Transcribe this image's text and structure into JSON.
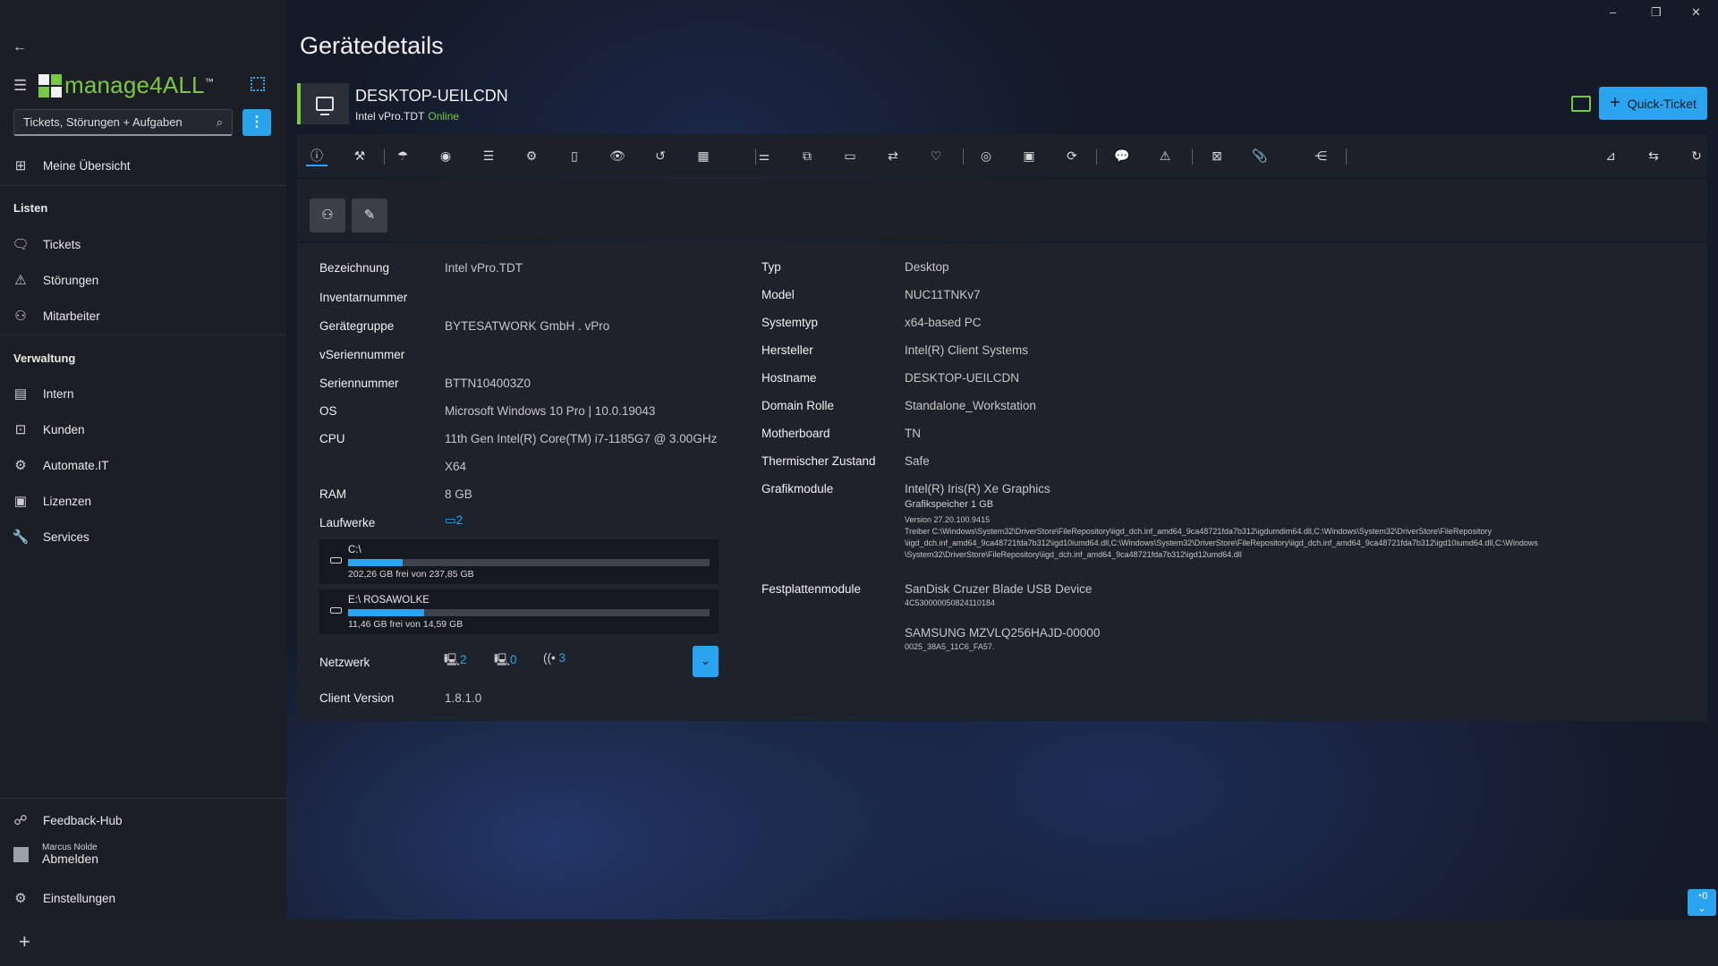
{
  "app": {
    "logo_text": "manage4ALL",
    "logo_tm": "™",
    "window_controls": [
      "–",
      "❐",
      "✕"
    ]
  },
  "search": {
    "placeholder": "Tickets, Störungen + Aufgaben"
  },
  "nav": {
    "overview": "Meine Übersicht",
    "lists_heading": "Listen",
    "tickets": "Tickets",
    "stoerungen": "Störungen",
    "mitarbeiter": "Mitarbeiter",
    "admin_heading": "Verwaltung",
    "intern": "Intern",
    "kunden": "Kunden",
    "automate": "Automate.IT",
    "lizenzen": "Lizenzen",
    "services": "Services",
    "feedback": "Feedback-Hub",
    "user_name": "Marcus Nolde",
    "logout": "Abmelden",
    "settings": "Einstellungen"
  },
  "page": {
    "title": "Gerätedetails"
  },
  "device": {
    "name": "DESKTOP-UEILCDN",
    "sub": "Intel vPro.TDT",
    "status": "Online",
    "status_color": "#7ac943"
  },
  "header": {
    "quick_ticket": "Quick-Ticket",
    "accent": "#2aa4ee"
  },
  "toolbar": {
    "icons": [
      "info-icon",
      "wrench-icon",
      "umbrella-icon",
      "target-icon",
      "list-icon",
      "cogs-icon",
      "battery-icon",
      "eye-icon",
      "history-icon",
      "calendar-icon",
      "sliders-icon",
      "package-icon",
      "monitor-icon",
      "transfer-icon",
      "heartbeat-icon",
      "camera-icon",
      "storage-icon",
      "refresh-icon",
      "chat-icon",
      "warning-icon",
      "badge-icon",
      "paperclip-icon",
      "share-icon",
      "chart-icon",
      "sync-icon",
      "reload-icon"
    ]
  },
  "left": {
    "bezeichnung_l": "Bezeichnung",
    "bezeichnung_v": "Intel vPro.TDT",
    "inventar_l": "Inventarnummer",
    "gruppe_l": "Gerätegruppe",
    "gruppe_v": "BYTESATWORK GmbH . vPro",
    "vserien_l": "vSeriennummer",
    "serien_l": "Seriennummer",
    "serien_v": "BTTN104003Z0",
    "os_l": "OS",
    "os_v": "Microsoft Windows 10 Pro | 10.0.19043",
    "cpu_l": "CPU",
    "cpu_v": "11th Gen Intel(R) Core(TM) i7-1185G7 @ 3.00GHz",
    "cpu_arch": "X64",
    "ram_l": "RAM",
    "ram_v": "8 GB",
    "laufwerke_l": "Laufwerke",
    "laufwerke_count": "2",
    "drives": [
      {
        "name": "C:\\",
        "free": "202,26 GB frei von 237,85 GB",
        "used_fraction": 0.15
      },
      {
        "name": "E:\\ ROSAWOLKE",
        "free": "11,46 GB frei von 14,59 GB",
        "used_fraction": 0.21
      }
    ],
    "netzwerk_l": "Netzwerk",
    "net_lan": "2",
    "net_other": "0",
    "net_wifi": "3",
    "client_l": "Client Version",
    "client_v": "1.8.1.0"
  },
  "right": {
    "typ_l": "Typ",
    "typ_v": "Desktop",
    "model_l": "Model",
    "model_v": "NUC11TNKv7",
    "systemtyp_l": "Systemtyp",
    "systemtyp_v": "x64-based PC",
    "hersteller_l": "Hersteller",
    "hersteller_v": "Intel(R) Client Systems",
    "hostname_l": "Hostname",
    "hostname_v": "DESKTOP-UEILCDN",
    "domain_l": "Domain Rolle",
    "domain_v": "Standalone_Workstation",
    "mb_l": "Motherboard",
    "mb_v": "TN",
    "thermal_l": "Thermischer Zustand",
    "thermal_v": "Safe",
    "grafik_l": "Grafikmodule",
    "grafik_v": "Intel(R) Iris(R) Xe Graphics",
    "grafik_mem": "Grafikspeicher 1 GB",
    "grafik_ver": "Version 27.20.100.9415",
    "grafik_driver_1": "Treiber C:\\Windows\\System32\\DriverStore\\FileRepository\\iigd_dch.inf_amd64_9ca48721fda7b312\\igdumdim64.dll,C:\\Windows\\System32\\DriverStore\\FileRepository",
    "grafik_driver_2": "\\iigd_dch.inf_amd64_9ca48721fda7b312\\igd10iumd64.dll,C:\\Windows\\System32\\DriverStore\\FileRepository\\iigd_dch.inf_amd64_9ca48721fda7b312\\igd10iumd64.dll,C:\\Windows",
    "grafik_driver_3": "\\System32\\DriverStore\\FileRepository\\iigd_dch.inf_amd64_9ca48721fda7b312\\igd12umd64.dll",
    "disk_l": "Festplattenmodule",
    "disk1_v": "SanDisk Cruzer Blade USB Device",
    "disk1_sn": "4C530000050824110184",
    "disk2_v": "SAMSUNG MZVLQ256HAJD-00000",
    "disk2_sn": "0025_38A5_11C6_FA57."
  },
  "fab": {
    "count": "0"
  }
}
